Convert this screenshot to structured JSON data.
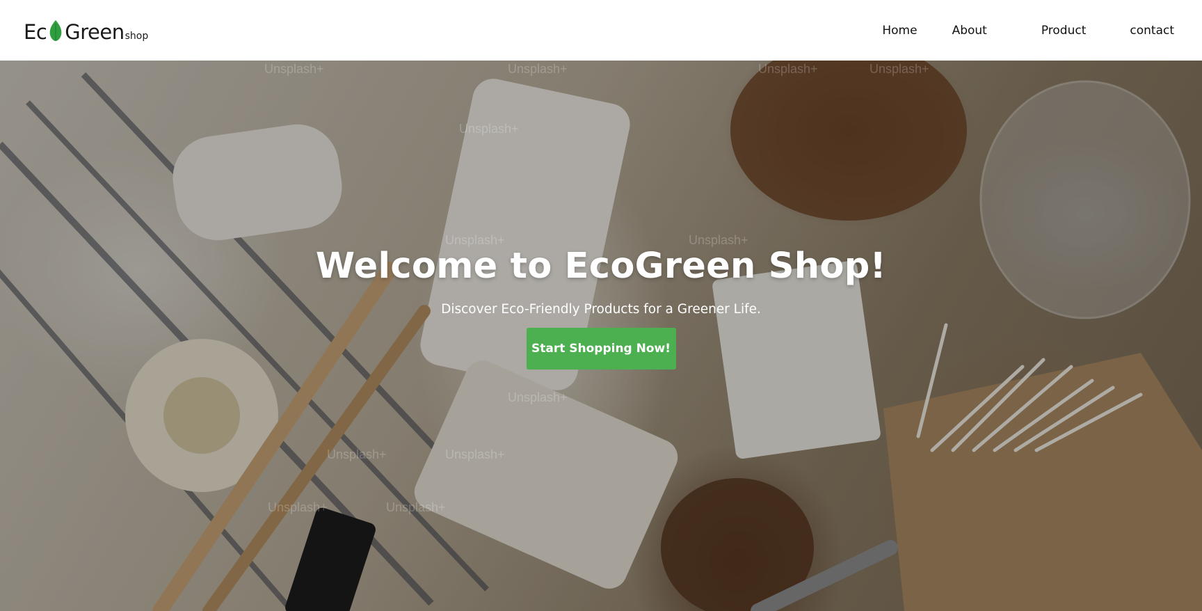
{
  "brand": {
    "logo_part1": "Ec",
    "logo_part2": "Green",
    "logo_suffix": "shop",
    "leaf_color": "#2e9e3e"
  },
  "nav": {
    "items": [
      {
        "label": "Home"
      },
      {
        "label": "About"
      },
      {
        "label": "Product"
      },
      {
        "label": "contact"
      }
    ]
  },
  "hero": {
    "title": "Welcome to EcoGreen Shop!",
    "subtitle": "Discover Eco-Friendly Products for a Greener Life.",
    "cta_label": "Start Shopping Now!",
    "cta_color": "#4caf50",
    "watermark": "Unsplash+"
  }
}
